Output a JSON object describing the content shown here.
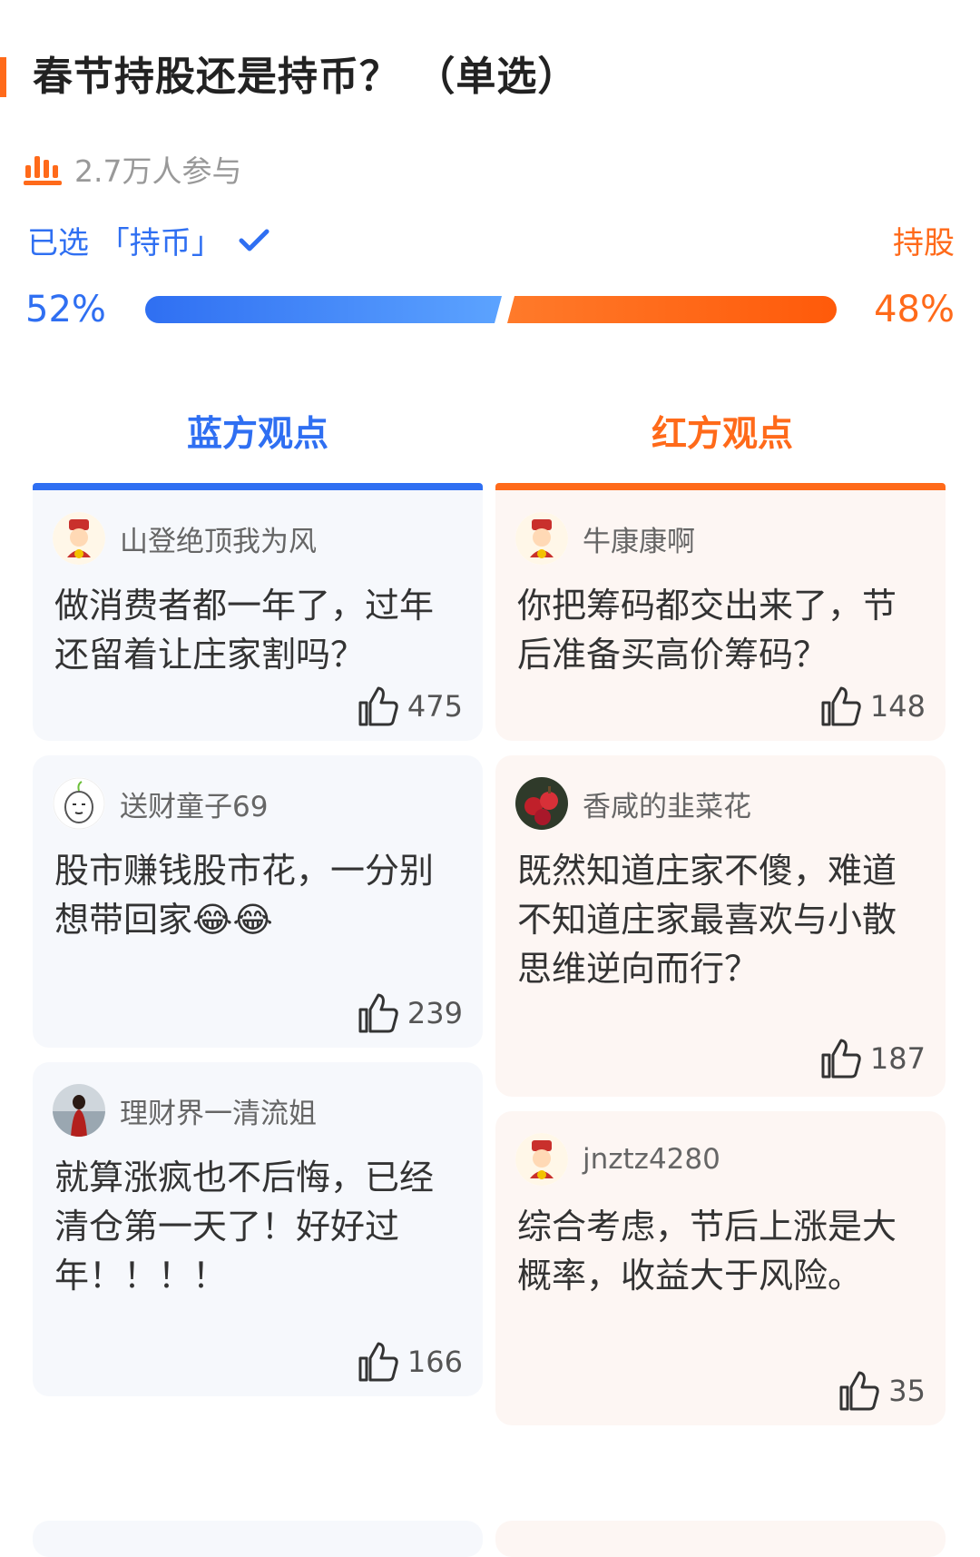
{
  "poll": {
    "title": "春节持股还是持币？  （单选）",
    "participants": "2.7万人参与",
    "selected_label": "已选 「持币」",
    "other_option": "持股",
    "left_percent": "52%",
    "right_percent": "48%",
    "left_share": 0.52,
    "right_share": 0.48
  },
  "tabs": {
    "blue": "蓝方观点",
    "red": "红方观点"
  },
  "colors": {
    "blue": "#2f6ff2",
    "orange": "#ff6a1a"
  },
  "blue_posts": [
    {
      "user": "山登绝顶我为风",
      "avatar": "fortune-god-avatar",
      "text": "做消费者都一年了，过年还留着让庄家割吗？",
      "likes": "475"
    },
    {
      "user": "送财童子69",
      "avatar": "cartoon-face-avatar",
      "text": "股市赚钱股市花，一分别想带回家😂😂",
      "likes": "239"
    },
    {
      "user": "理财界一清流姐",
      "avatar": "photo-avatar",
      "text": "就算涨疯也不后悔，已经清仓第一天了！好好过年！！！！",
      "likes": "166"
    }
  ],
  "red_posts": [
    {
      "user": "牛康康啊",
      "avatar": "fortune-god-avatar",
      "text": "你把筹码都交出来了，节后准备买高价筹码？",
      "likes": "148"
    },
    {
      "user": "香咸的韭菜花",
      "avatar": "apple-photo-avatar",
      "text": "既然知道庄家不傻，难道不知道庄家最喜欢与小散思维逆向而行？",
      "likes": "187"
    },
    {
      "user": "jnztz4280",
      "avatar": "fortune-god-avatar",
      "text": "综合考虑，节后上涨是大概率，收益大于风险。",
      "likes": "35"
    }
  ],
  "icons": {
    "participants": "bar-chart-icon",
    "selected": "check-icon",
    "like": "thumbs-up-icon"
  }
}
